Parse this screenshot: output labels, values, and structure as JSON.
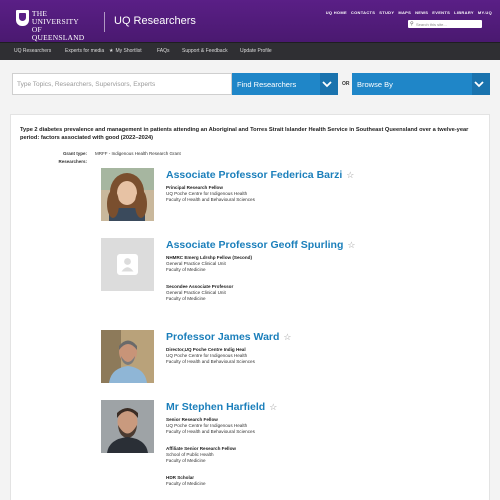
{
  "header": {
    "logo_line1": "THE UNIVERSITY",
    "logo_line2": "OF QUEENSLAND",
    "logo_line3": "AUSTRALIA",
    "site_title": "UQ Researchers",
    "top_links": [
      "UQ HOME",
      "CONTACTS",
      "STUDY",
      "MAPS",
      "NEWS",
      "EVENTS",
      "LIBRARY",
      "MY.UQ"
    ],
    "search_placeholder": "Search this site..."
  },
  "nav": {
    "items": [
      "UQ Researchers",
      "Experts for media",
      "My Shortlist",
      "FAQs",
      "Support & Feedback",
      "Update Profile"
    ]
  },
  "search": {
    "topic_placeholder": "Type Topics, Researchers, Supervisors, Experts",
    "find_label": "Find Researchers",
    "or_label": "OR",
    "browse_label": "Browse By"
  },
  "grant": {
    "title": "Type 2 diabetes prevalence and management in patients attending an Aboriginal and Torres Strait Islander Health Service in Southeast Queensland over a twelve-year period: factors associated with good (2022–2024)",
    "type_label": "Grant type:",
    "type_value": "MRFF - Indigenous Health Research Grant",
    "researchers_label": "Researchers:"
  },
  "researchers": [
    {
      "name": "Associate Professor Federica Barzi",
      "roles": [
        {
          "title": "Principal Research Fellow",
          "lines": [
            "UQ Poche Centre for Indigenous Health",
            "Faculty of Health and Behavioural Sciences"
          ]
        }
      ]
    },
    {
      "name": "Associate Professor Geoff Spurling",
      "roles": [
        {
          "title": "NHMRC Emerg Ldrshp Fellow (Second)",
          "lines": [
            "General Practice Clinical Unit",
            "Faculty of Medicine"
          ]
        },
        {
          "title": "Secondee Associate Professor",
          "lines": [
            "General Practice Clinical Unit",
            "Faculty of Medicine"
          ]
        }
      ]
    },
    {
      "name": "Professor James Ward",
      "roles": [
        {
          "title": "Director,UQ Poche Centre Indig Heal",
          "lines": [
            "UQ Poche Centre for Indigenous Health",
            "Faculty of Health and Behavioural Sciences"
          ]
        }
      ]
    },
    {
      "name": "Mr Stephen Harfield",
      "roles": [
        {
          "title": "Senior Research Fellow",
          "lines": [
            "UQ Poche Centre for Indigenous Health",
            "Faculty of Health and Behavioural Sciences"
          ]
        },
        {
          "title": "Affiliate Senior Research Fellow",
          "lines": [
            "School of Public Health",
            "Faculty of Medicine"
          ]
        },
        {
          "title": "HDR Scholar",
          "lines": [
            "Faculty of Medicine"
          ]
        }
      ]
    }
  ],
  "colors": {
    "brand_purple": "#51247a",
    "link_blue": "#1b7fbb",
    "button_blue": "#1f86c8",
    "nav_dark": "#2f2f33"
  }
}
